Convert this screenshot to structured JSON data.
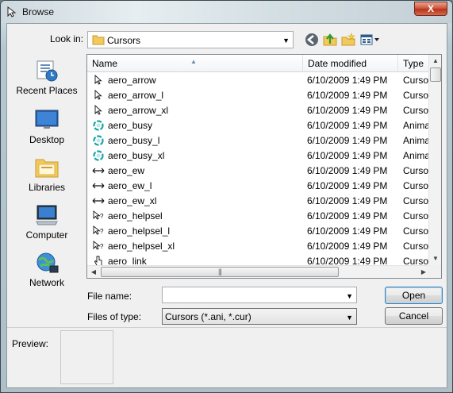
{
  "window": {
    "title": "Browse",
    "close_label": "X"
  },
  "toolbar": {
    "look_in_label": "Look in:",
    "look_in_value": "Cursors",
    "buttons": [
      "back-icon",
      "up-folder-icon",
      "new-folder-icon",
      "view-menu-icon"
    ]
  },
  "places": [
    {
      "label": "Recent Places",
      "icon": "recent-places-icon"
    },
    {
      "label": "Desktop",
      "icon": "desktop-icon"
    },
    {
      "label": "Libraries",
      "icon": "libraries-icon"
    },
    {
      "label": "Computer",
      "icon": "computer-icon"
    },
    {
      "label": "Network",
      "icon": "network-icon"
    }
  ],
  "list": {
    "columns": [
      "Name",
      "Date modified",
      "Type"
    ],
    "rows": [
      {
        "name": "aero_arrow",
        "date": "6/10/2009 1:49 PM",
        "type": "Cursor",
        "icon": "arrow-cursor-icon"
      },
      {
        "name": "aero_arrow_l",
        "date": "6/10/2009 1:49 PM",
        "type": "Cursor",
        "icon": "arrow-cursor-icon"
      },
      {
        "name": "aero_arrow_xl",
        "date": "6/10/2009 1:49 PM",
        "type": "Cursor",
        "icon": "arrow-cursor-icon"
      },
      {
        "name": "aero_busy",
        "date": "6/10/2009 1:49 PM",
        "type": "Anima",
        "icon": "busy-cursor-icon"
      },
      {
        "name": "aero_busy_l",
        "date": "6/10/2009 1:49 PM",
        "type": "Anima",
        "icon": "busy-cursor-icon"
      },
      {
        "name": "aero_busy_xl",
        "date": "6/10/2009 1:49 PM",
        "type": "Anima",
        "icon": "busy-cursor-icon"
      },
      {
        "name": "aero_ew",
        "date": "6/10/2009 1:49 PM",
        "type": "Cursor",
        "icon": "resize-ew-cursor-icon"
      },
      {
        "name": "aero_ew_l",
        "date": "6/10/2009 1:49 PM",
        "type": "Cursor",
        "icon": "resize-ew-cursor-icon"
      },
      {
        "name": "aero_ew_xl",
        "date": "6/10/2009 1:49 PM",
        "type": "Cursor",
        "icon": "resize-ew-cursor-icon"
      },
      {
        "name": "aero_helpsel",
        "date": "6/10/2009 1:49 PM",
        "type": "Cursor",
        "icon": "help-cursor-icon"
      },
      {
        "name": "aero_helpsel_l",
        "date": "6/10/2009 1:49 PM",
        "type": "Cursor",
        "icon": "help-cursor-icon"
      },
      {
        "name": "aero_helpsel_xl",
        "date": "6/10/2009 1:49 PM",
        "type": "Cursor",
        "icon": "help-cursor-icon"
      },
      {
        "name": "aero_link",
        "date": "6/10/2009 1:49 PM",
        "type": "Cursor",
        "icon": "hand-cursor-icon"
      }
    ]
  },
  "file_name": {
    "label": "File name:",
    "value": ""
  },
  "file_type": {
    "label": "Files of type:",
    "value": "Cursors (*.ani, *.cur)"
  },
  "buttons": {
    "open": "Open",
    "cancel": "Cancel"
  },
  "preview": {
    "label": "Preview:"
  },
  "colors": {
    "accent": "#3c7fb1",
    "close": "#c9452c"
  }
}
